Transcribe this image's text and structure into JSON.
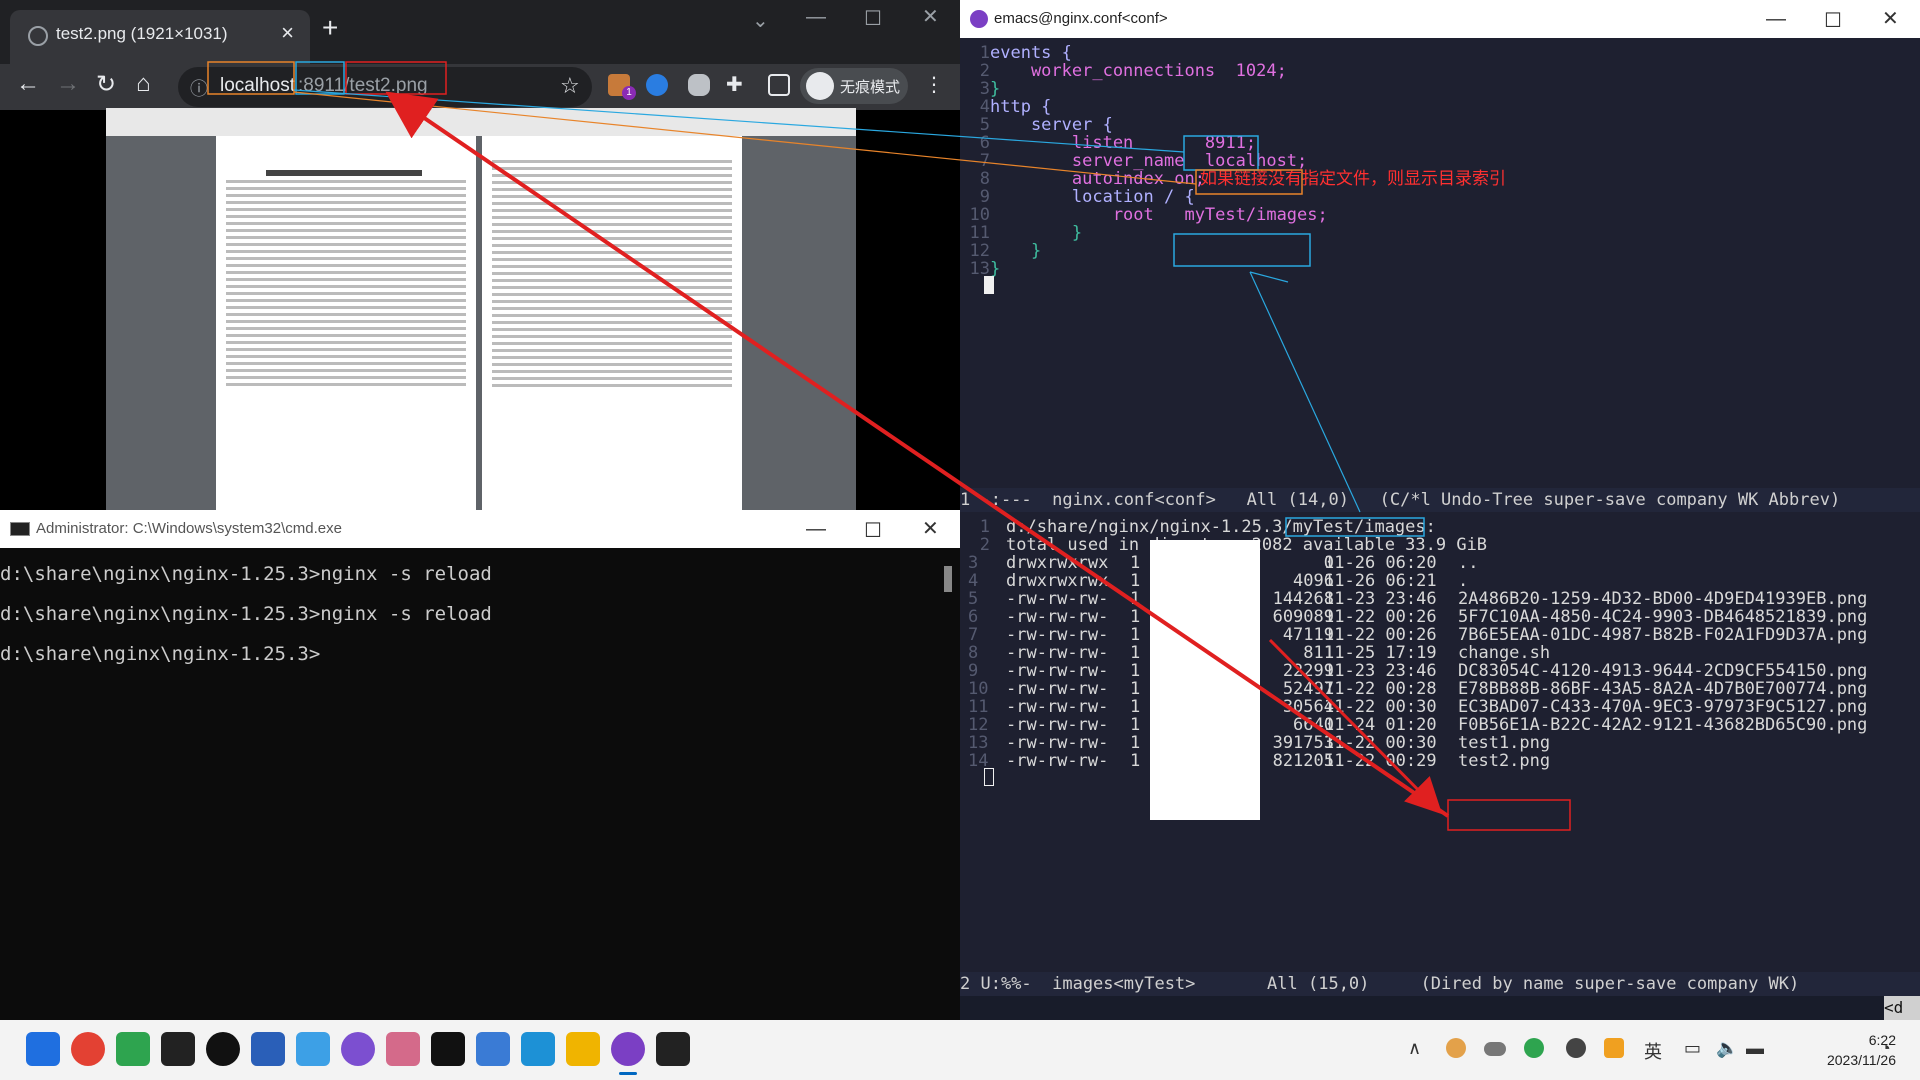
{
  "chrome": {
    "tab_title": "test2.png (1921×1031)",
    "url_host": "localhost",
    "url_port": ":8911/",
    "url_path": "test2.png",
    "incognito_label": "无痕模式",
    "ext_badge": "1"
  },
  "cmd": {
    "title": "Administrator: C:\\Windows\\system32\\cmd.exe",
    "lines": [
      "d:\\share\\nginx\\nginx-1.25.3>nginx -s reload",
      "d:\\share\\nginx\\nginx-1.25.3>nginx -s reload",
      "d:\\share\\nginx\\nginx-1.25.3>"
    ]
  },
  "emacs": {
    "title": "emacs@nginx.conf<conf>",
    "config_lines": [
      {
        "n": "1",
        "text": "events {"
      },
      {
        "n": "2",
        "text": "    worker_connections  1024;"
      },
      {
        "n": "3",
        "text": "}"
      },
      {
        "n": "4",
        "text": "http {"
      },
      {
        "n": "5",
        "text": "    server {"
      },
      {
        "n": "6",
        "text": "        listen       8911;"
      },
      {
        "n": "7",
        "text": "        server_name  localhost;"
      },
      {
        "n": "8",
        "text": "        autoindex on;"
      },
      {
        "n": "9",
        "text": "        location / {"
      },
      {
        "n": "10",
        "text": "            root   myTest/images;"
      },
      {
        "n": "11",
        "text": "        }"
      },
      {
        "n": "12",
        "text": "    }"
      },
      {
        "n": "13",
        "text": "}"
      }
    ],
    "annotation_text": "如果链接没有指定文件，则显示目录索引",
    "modeline1": "1 -:---  nginx.conf<conf>   All (14,0)   (C/*l Undo-Tree super-save company WK Abbrev)",
    "dired_header": "d:/share/nginx/nginx-1.25.3/myTest/images:",
    "dired_total": "total used in directory 2082 available 33.9 GiB",
    "dired_rows": [
      {
        "n": "3",
        "perm": "drwxrwxrwx",
        "links": "1",
        "size": "0",
        "date": "11-26 06:20",
        "name": ".."
      },
      {
        "n": "4",
        "perm": "drwxrwxrwx",
        "links": "1",
        "size": "4096",
        "date": "11-26 06:21",
        "name": "."
      },
      {
        "n": "5",
        "perm": "-rw-rw-rw-",
        "links": "1",
        "size": "144268",
        "date": "11-23 23:46",
        "name": "2A486B20-1259-4D32-BD00-4D9ED41939EB.png"
      },
      {
        "n": "6",
        "perm": "-rw-rw-rw-",
        "links": "1",
        "size": "609089",
        "date": "11-22 00:26",
        "name": "5F7C10AA-4850-4C24-9903-DB4648521839.png"
      },
      {
        "n": "7",
        "perm": "-rw-rw-rw-",
        "links": "1",
        "size": "47119",
        "date": "11-22 00:26",
        "name": "7B6E5EAA-01DC-4987-B82B-F02A1FD9D37A.png"
      },
      {
        "n": "8",
        "perm": "-rw-rw-rw-",
        "links": "1",
        "size": "811",
        "date": "11-25 17:19",
        "name": "change.sh"
      },
      {
        "n": "9",
        "perm": "-rw-rw-rw-",
        "links": "1",
        "size": "22299",
        "date": "11-23 23:46",
        "name": "DC83054C-4120-4913-9644-2CD9CF554150.png"
      },
      {
        "n": "10",
        "perm": "-rw-rw-rw-",
        "links": "1",
        "size": "52497",
        "date": "11-22 00:28",
        "name": "E78BB88B-86BF-43A5-8A2A-4D7B0E700774.png"
      },
      {
        "n": "11",
        "perm": "-rw-rw-rw-",
        "links": "1",
        "size": "30564",
        "date": "11-22 00:30",
        "name": "EC3BAD07-C433-470A-9EC3-97973F9C5127.png"
      },
      {
        "n": "12",
        "perm": "-rw-rw-rw-",
        "links": "1",
        "size": "6640",
        "date": "11-24 01:20",
        "name": "F0B56E1A-B22C-42A2-9121-43682BD65C90.png"
      },
      {
        "n": "13",
        "perm": "-rw-rw-rw-",
        "links": "1",
        "size": "391753",
        "date": "11-22 00:30",
        "name": "test1.png"
      },
      {
        "n": "14",
        "perm": "-rw-rw-rw-",
        "links": "1",
        "size": "821205",
        "date": "11-22 00:29",
        "name": "test2.png"
      }
    ],
    "modeline2": "2 U:%%-  images<myTest>       All (15,0)     (Dired by name super-save company WK)",
    "mini_tail": "<d"
  },
  "taskbar": {
    "time": "6:22",
    "date": "2023/11/26",
    "ime": "英",
    "apps": [
      "windows-start",
      "chrome",
      "wechat",
      "terminal",
      "qq",
      "mp",
      "app-blue",
      "app-purple",
      "app-colorful",
      "tiktok",
      "app-box",
      "docker",
      "file-explorer",
      "emacs",
      "cmd"
    ]
  },
  "colors": {
    "annotation_red": "#e02020",
    "annotation_blue": "#2aa8e0",
    "annotation_orange": "#e8842a"
  }
}
